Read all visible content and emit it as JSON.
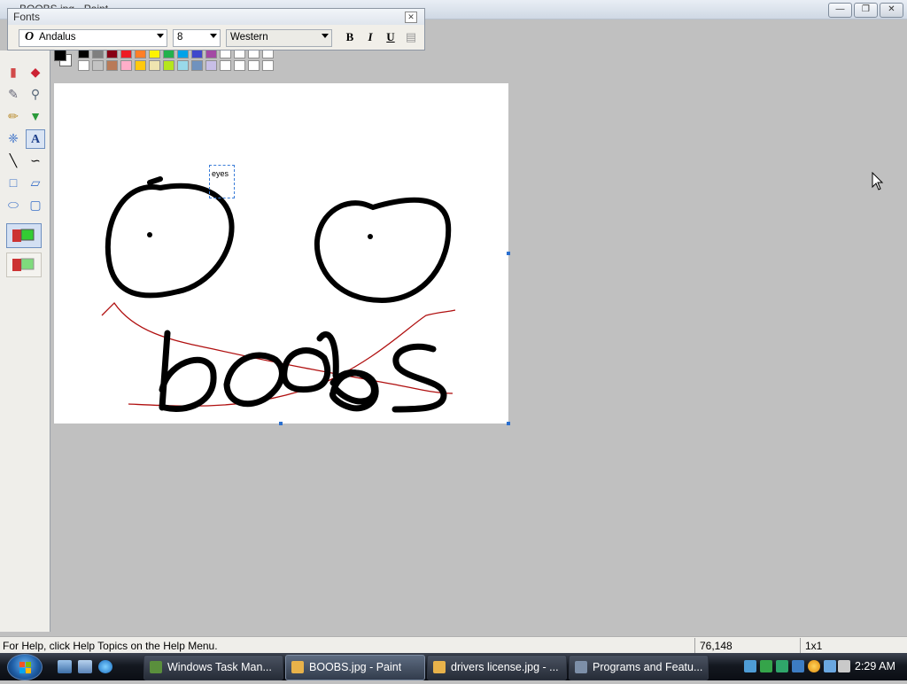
{
  "window": {
    "title": "BOOBS.jpg - Paint"
  },
  "fonts_toolbar": {
    "caption": "Fonts",
    "font_name": "Andalus",
    "font_size": "8",
    "charset": "Western",
    "bold_label": "B",
    "italic_label": "I",
    "underline_label": "U"
  },
  "palette": {
    "foreground": "#000000",
    "background": "#ffffff",
    "row1": [
      "#000000",
      "#7f7f7f",
      "#880015",
      "#ed1c24",
      "#ff7f27",
      "#fff200",
      "#22b14c",
      "#00a2e8",
      "#3f48cc",
      "#a349a4",
      "#ffffff",
      "#ffffff",
      "#ffffff",
      "#ffffff"
    ],
    "row2": [
      "#ffffff",
      "#c3c3c3",
      "#b97a57",
      "#ffaec9",
      "#ffc90e",
      "#efe4b0",
      "#b5e61d",
      "#99d9ea",
      "#7092be",
      "#c8bfe7",
      "#ffffff",
      "#ffffff",
      "#ffffff",
      "#ffffff"
    ]
  },
  "canvas": {
    "text_box_content": "eyes"
  },
  "status": {
    "help_text": "For Help, click Help Topics on the Help Menu.",
    "coordinates": "76,148",
    "selection_size": "1x1"
  },
  "taskbar": {
    "tasks": [
      {
        "label": "Windows Task Man...",
        "icon": "task-manager-icon",
        "color": "#5a8f3c"
      },
      {
        "label": "BOOBS.jpg - Paint",
        "icon": "paint-icon",
        "color": "#e8b24a"
      },
      {
        "label": "drivers license.jpg - ...",
        "icon": "paint-icon",
        "color": "#e8b24a"
      },
      {
        "label": "Programs and Featu...",
        "icon": "control-panel-icon",
        "color": "#7d8fa8"
      }
    ],
    "clock": "2:29 AM"
  }
}
